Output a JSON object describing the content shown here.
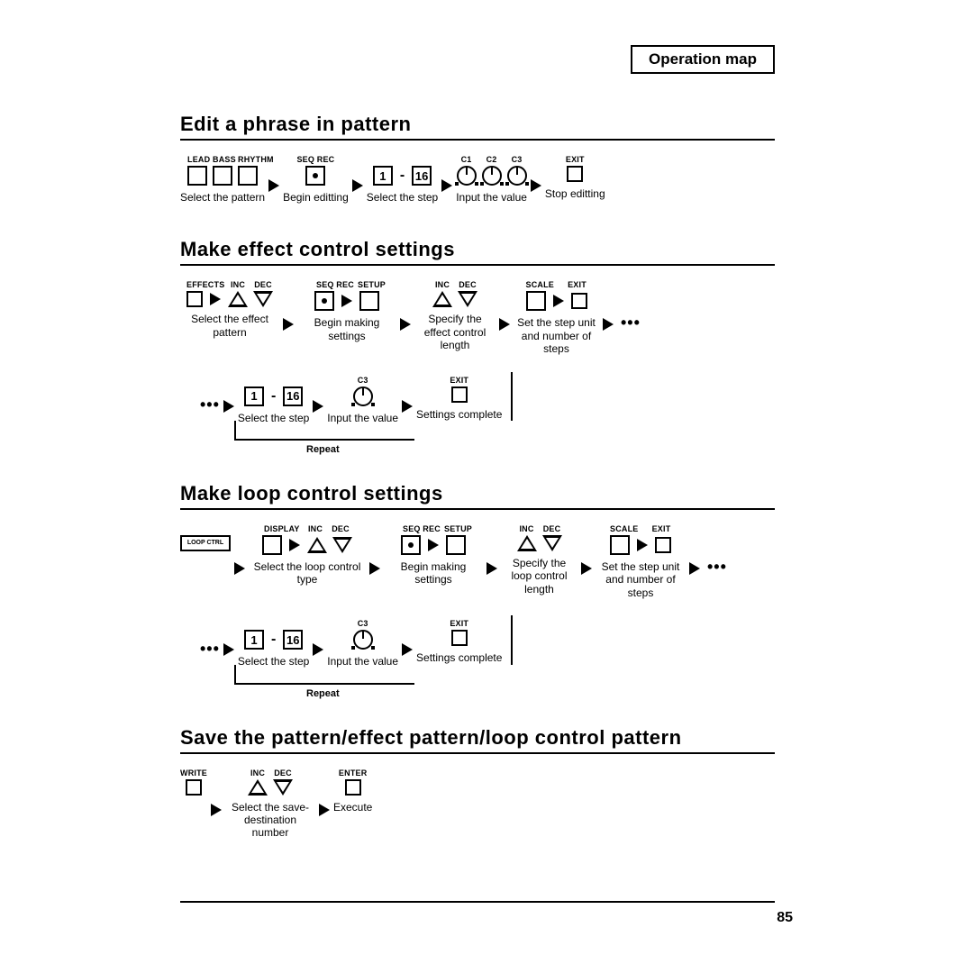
{
  "header": "Operation map",
  "page_number": "85",
  "sections": {
    "edit": {
      "title": "Edit a phrase in pattern",
      "labels": {
        "lead": "LEAD",
        "bass": "BASS",
        "rhythm": "RHYTHM",
        "seqrec": "SEQ REC",
        "one": "1",
        "sixteen": "16",
        "c1": "C1",
        "c2": "C2",
        "c3": "C3",
        "exit": "EXIT"
      },
      "captions": {
        "select_pattern": "Select the pattern",
        "begin_edit": "Begin editting",
        "select_step": "Select the step",
        "input_value": "Input the value",
        "stop_edit": "Stop editting"
      }
    },
    "effect": {
      "title": "Make effect control settings",
      "labels": {
        "effects": "EFFECTS",
        "inc": "INC",
        "dec": "DEC",
        "seqrec": "SEQ REC",
        "setup": "SETUP",
        "scale": "SCALE",
        "exit": "EXIT",
        "one": "1",
        "sixteen": "16",
        "c3": "C3"
      },
      "captions": {
        "select_effect_pattern": "Select the effect pattern",
        "begin_settings": "Begin making settings",
        "specify_length": "Specify the effect control length",
        "set_step": "Set the step unit and number of steps",
        "select_step": "Select the step",
        "input_value": "Input the value",
        "settings_complete": "Settings complete",
        "repeat": "Repeat"
      }
    },
    "loop": {
      "title": "Make loop control settings",
      "labels": {
        "loopctrl": "LOOP CTRL",
        "display": "DISPLAY",
        "inc": "INC",
        "dec": "DEC",
        "seqrec": "SEQ REC",
        "setup": "SETUP",
        "scale": "SCALE",
        "exit": "EXIT",
        "one": "1",
        "sixteen": "16",
        "c3": "C3"
      },
      "captions": {
        "select_loop_type": "Select the loop control type",
        "begin_settings": "Begin making settings",
        "specify_length": "Specify the loop control length",
        "set_step": "Set the step unit and number of steps",
        "select_step": "Select the step",
        "input_value": "Input the value",
        "settings_complete": "Settings complete",
        "repeat": "Repeat"
      }
    },
    "save": {
      "title": "Save the pattern/effect pattern/loop control pattern",
      "labels": {
        "write": "WRITE",
        "inc": "INC",
        "dec": "DEC",
        "enter": "ENTER"
      },
      "captions": {
        "select_dest": "Select the save-destination number",
        "execute": "Execute"
      }
    }
  }
}
